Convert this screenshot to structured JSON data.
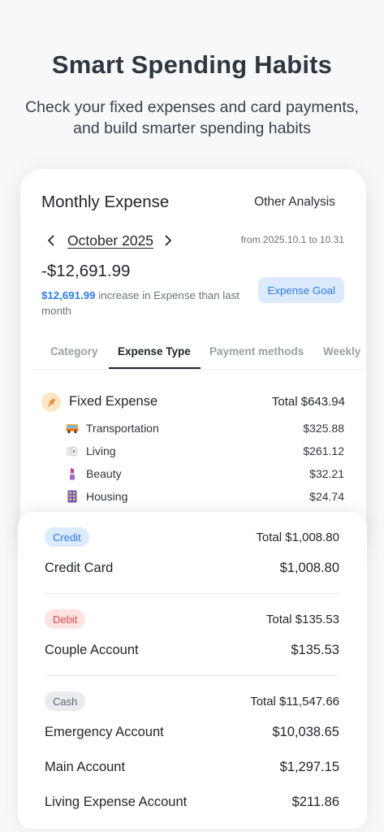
{
  "hero": {
    "title": "Smart Spending Habits",
    "subtitle_line1": "Check your fixed expenses and card payments,",
    "subtitle_line2": "and build smarter spending habits"
  },
  "expense_card": {
    "title": "Monthly Expense",
    "other_analysis": "Other Analysis",
    "month": "October 2025",
    "date_range": "from 2025.10.1 to 10.31",
    "total_amount": "-$12,691.99",
    "compare_highlight": "$12,691.99",
    "compare_text": " increase in Expense than last month",
    "goal_button": "Expense Goal",
    "tabs": [
      "Category",
      "Expense Type",
      "Payment methods",
      "Weekly"
    ],
    "active_tab": "Expense Type",
    "fixed_expense": {
      "label": "Fixed Expense",
      "total": "Total $643.94",
      "items": [
        {
          "label": "Transportation",
          "amount": "$325.88",
          "icon": "bus-icon"
        },
        {
          "label": "Living",
          "amount": "$261.12",
          "icon": "toilet-paper-icon"
        },
        {
          "label": "Beauty",
          "amount": "$32.21",
          "icon": "lipstick-icon"
        },
        {
          "label": "Housing",
          "amount": "$24.74",
          "icon": "building-icon"
        }
      ]
    }
  },
  "payment_card": {
    "sections": [
      {
        "badge": "Credit",
        "total": "Total $1,008.80",
        "accounts": [
          {
            "label": "Credit Card",
            "amount": "$1,008.80"
          }
        ]
      },
      {
        "badge": "Debit",
        "total": "Total $135.53",
        "accounts": [
          {
            "label": "Couple Account",
            "amount": "$135.53"
          }
        ]
      },
      {
        "badge": "Cash",
        "total": "Total $11,547.66",
        "accounts": [
          {
            "label": "Emergency Account",
            "amount": "$10,038.65"
          },
          {
            "label": "Main Account",
            "amount": "$1,297.15"
          },
          {
            "label": "Living Expense Account",
            "amount": "$211.86"
          }
        ]
      }
    ]
  },
  "colors": {
    "accent_blue": "#2d7be8",
    "credit_badge_bg": "#dbeafd",
    "debit_badge_bg": "#fde2e2",
    "debit_text": "#e5484d",
    "cash_badge_bg": "#e9ebee"
  }
}
